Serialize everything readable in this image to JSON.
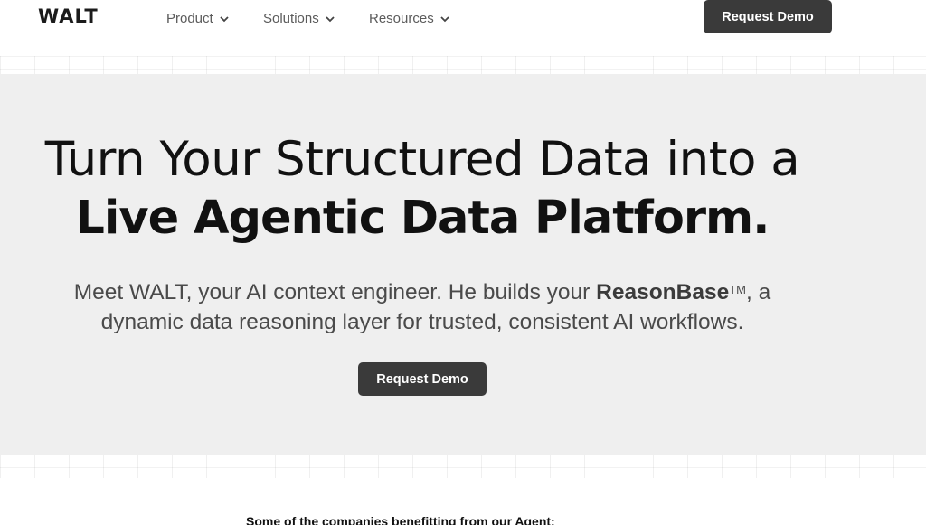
{
  "nav": {
    "logo": "WALT",
    "items": [
      {
        "label": "Product"
      },
      {
        "label": "Solutions"
      },
      {
        "label": "Resources"
      }
    ],
    "cta": "Request Demo"
  },
  "hero": {
    "headline_line1": "Turn Your Structured Data into a",
    "headline_line2": "Live Agentic Data Platform.",
    "sub_part1": "Meet WALT, your AI context engineer. He builds your ",
    "sub_brand": "ReasonBase",
    "sub_tm": "TM",
    "sub_part2": ", a",
    "sub_line2": "dynamic data reasoning layer for trusted, consistent AI workflows.",
    "cta": "Request Demo"
  },
  "logos_section": {
    "heading": "Some of the companies benefitting from our Agent:"
  },
  "colors": {
    "hero_bg": "#efefef",
    "button_bg": "#3a3a3a",
    "nav_text": "#5b5b5b"
  },
  "icons": [
    "chevron-down-icon"
  ]
}
